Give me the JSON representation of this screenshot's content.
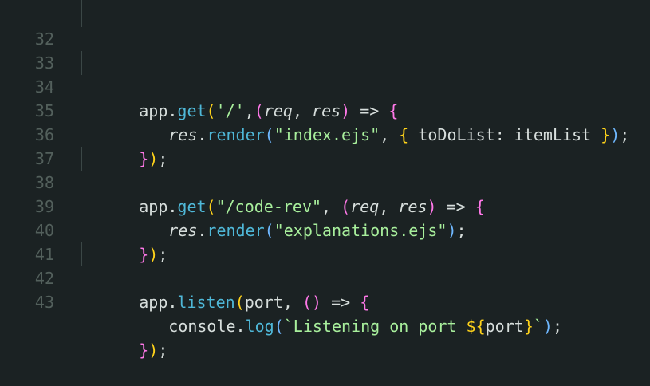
{
  "editor": {
    "lines": [
      {
        "number": "32",
        "tokens": []
      },
      {
        "number": "33",
        "tokens": [
          {
            "text": "app",
            "color": "white"
          },
          {
            "text": ".",
            "color": "white"
          },
          {
            "text": "get",
            "color": "function"
          },
          {
            "text": "(",
            "color": "yellow"
          },
          {
            "text": "'/'",
            "color": "string"
          },
          {
            "text": ",",
            "color": "white"
          },
          {
            "text": "(",
            "color": "magenta"
          },
          {
            "text": "req",
            "color": "param"
          },
          {
            "text": ", ",
            "color": "white"
          },
          {
            "text": "res",
            "color": "param"
          },
          {
            "text": ")",
            "color": "magenta"
          },
          {
            "text": " => ",
            "color": "white"
          },
          {
            "text": "{",
            "color": "magenta"
          }
        ]
      },
      {
        "number": "34",
        "indent": true,
        "tokens": [
          {
            "text": "res",
            "color": "param"
          },
          {
            "text": ".",
            "color": "white"
          },
          {
            "text": "render",
            "color": "function"
          },
          {
            "text": "(",
            "color": "blue"
          },
          {
            "text": "\"index.ejs\"",
            "color": "string"
          },
          {
            "text": ", ",
            "color": "white"
          },
          {
            "text": "{",
            "color": "yellow"
          },
          {
            "text": " toDoList",
            "color": "white"
          },
          {
            "text": ": ",
            "color": "white"
          },
          {
            "text": "itemList ",
            "color": "white"
          },
          {
            "text": "}",
            "color": "yellow"
          },
          {
            "text": ")",
            "color": "blue"
          },
          {
            "text": ";",
            "color": "white"
          }
        ]
      },
      {
        "number": "35",
        "tokens": [
          {
            "text": "}",
            "color": "magenta"
          },
          {
            "text": ")",
            "color": "yellow"
          },
          {
            "text": ";",
            "color": "white"
          }
        ]
      },
      {
        "number": "36",
        "tokens": []
      },
      {
        "number": "37",
        "tokens": [
          {
            "text": "app",
            "color": "white"
          },
          {
            "text": ".",
            "color": "white"
          },
          {
            "text": "get",
            "color": "function"
          },
          {
            "text": "(",
            "color": "yellow"
          },
          {
            "text": "\"/code-rev\"",
            "color": "string"
          },
          {
            "text": ", ",
            "color": "white"
          },
          {
            "text": "(",
            "color": "magenta"
          },
          {
            "text": "req",
            "color": "param"
          },
          {
            "text": ", ",
            "color": "white"
          },
          {
            "text": "res",
            "color": "param"
          },
          {
            "text": ")",
            "color": "magenta"
          },
          {
            "text": " => ",
            "color": "white"
          },
          {
            "text": "{",
            "color": "magenta"
          }
        ]
      },
      {
        "number": "38",
        "indent": true,
        "tokens": [
          {
            "text": "res",
            "color": "param"
          },
          {
            "text": ".",
            "color": "white"
          },
          {
            "text": "render",
            "color": "function"
          },
          {
            "text": "(",
            "color": "blue"
          },
          {
            "text": "\"explanations.ejs\"",
            "color": "string"
          },
          {
            "text": ")",
            "color": "blue"
          },
          {
            "text": ";",
            "color": "white"
          }
        ]
      },
      {
        "number": "39",
        "tokens": [
          {
            "text": "}",
            "color": "magenta"
          },
          {
            "text": ")",
            "color": "yellow"
          },
          {
            "text": ";",
            "color": "white"
          }
        ]
      },
      {
        "number": "40",
        "tokens": []
      },
      {
        "number": "41",
        "tokens": [
          {
            "text": "app",
            "color": "white"
          },
          {
            "text": ".",
            "color": "white"
          },
          {
            "text": "listen",
            "color": "function"
          },
          {
            "text": "(",
            "color": "yellow"
          },
          {
            "text": "port",
            "color": "white"
          },
          {
            "text": ", ",
            "color": "white"
          },
          {
            "text": "()",
            "color": "magenta"
          },
          {
            "text": " => ",
            "color": "white"
          },
          {
            "text": "{",
            "color": "magenta"
          }
        ]
      },
      {
        "number": "42",
        "indent": true,
        "tokens": [
          {
            "text": "console",
            "color": "white"
          },
          {
            "text": ".",
            "color": "white"
          },
          {
            "text": "log",
            "color": "function"
          },
          {
            "text": "(",
            "color": "blue"
          },
          {
            "text": "`Listening on port ",
            "color": "string"
          },
          {
            "text": "${",
            "color": "yellow"
          },
          {
            "text": "port",
            "color": "white"
          },
          {
            "text": "}",
            "color": "yellow"
          },
          {
            "text": "`",
            "color": "string"
          },
          {
            "text": ")",
            "color": "blue"
          },
          {
            "text": ";",
            "color": "white"
          }
        ]
      },
      {
        "number": "43",
        "tokens": [
          {
            "text": "}",
            "color": "magenta"
          },
          {
            "text": ")",
            "color": "yellow"
          },
          {
            "text": ";",
            "color": "white"
          }
        ]
      }
    ]
  },
  "theme": {
    "background": "#1b2223",
    "line_number": "#53605c",
    "function": "#4fb8d8",
    "param": "#d7dedc",
    "string": "#a8ef9c",
    "blue_bracket": "#6fb8ff",
    "yellow_bracket": "#ffd31a",
    "magenta_bracket": "#ff78e8",
    "text": "#d7dedc"
  }
}
